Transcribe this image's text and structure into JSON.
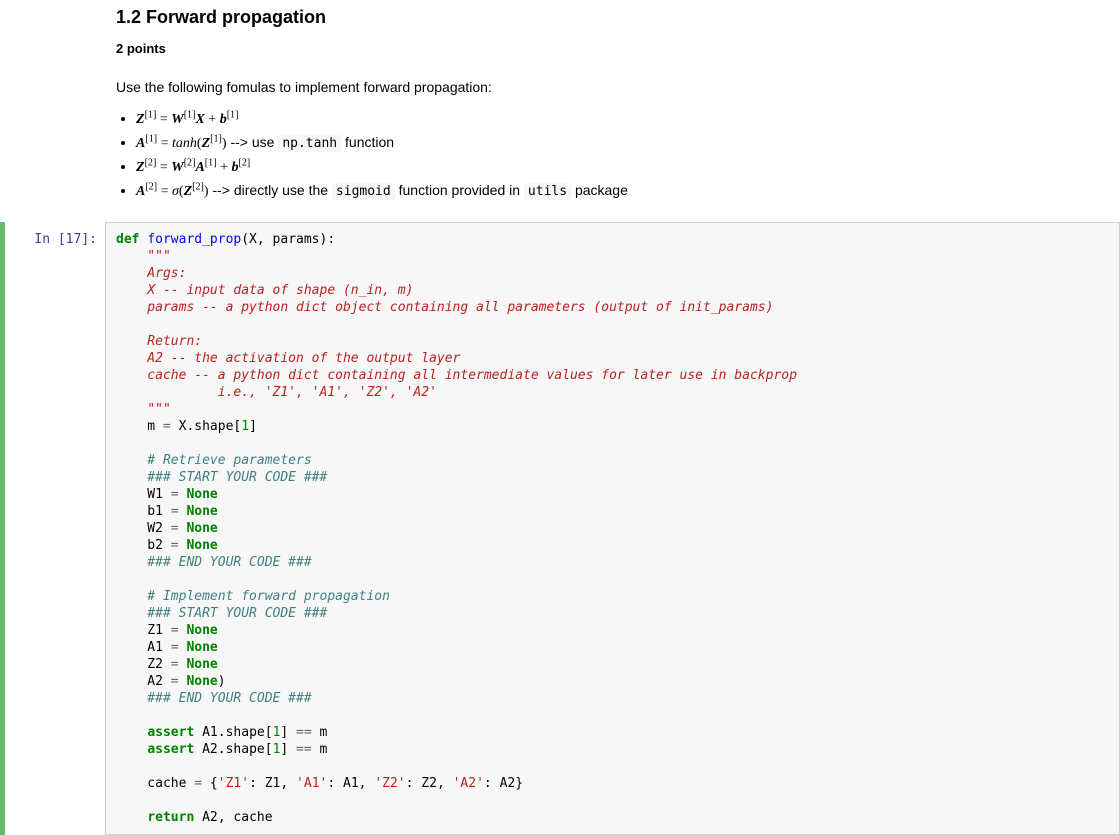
{
  "markdown": {
    "title": "1.2 Forward propagation",
    "points": "2 points",
    "intro": "Use the following fomulas to implement forward propagation:",
    "formula1_after": " --> use ",
    "formula1_code": "np.tanh",
    "formula1_tail": " function",
    "formula4_after": " --> directly use the ",
    "formula4_code1": "sigmoid",
    "formula4_mid": " function provided in ",
    "formula4_code2": "utils",
    "formula4_tail": " package"
  },
  "cell": {
    "prompt": "In [17]:",
    "line01_def": "def",
    "line01_fn": "forward_prop",
    "line01_rest": "(X, params):",
    "doc_open": "    \"\"\"",
    "doc_l1": "    Args:",
    "doc_l2": "    X -- input data of shape (n_in, m)",
    "doc_l3": "    params -- a python dict object containing all parameters (output of init_params)",
    "doc_blank": "    ",
    "doc_l4": "    Return:",
    "doc_l5": "    A2 -- the activation of the output layer",
    "doc_l6": "    cache -- a python dict containing all intermediate values for later use in backprop",
    "doc_l7": "             i.e., 'Z1', 'A1', 'Z2', 'A2'",
    "doc_close": "    \"\"\"",
    "m_line_a": "    m ",
    "eq": "=",
    "m_line_b": " X.shape[",
    "one": "1",
    "rb": "]",
    "cmt_retrieve": "    # Retrieve parameters",
    "cmt_start": "    ### START YOUR CODE ###",
    "w1": "    W1 ",
    "b1": "    b1 ",
    "w2": "    W2 ",
    "b2": "    b2 ",
    "none": "None",
    "cmt_end": "    ### END YOUR CODE ###",
    "cmt_impl": "    # Implement forward propagation",
    "z1": "    Z1 ",
    "a1": "    A1 ",
    "z2": "    Z2 ",
    "a2": "    A2 ",
    "a2_paren": ")",
    "assert_w": "assert",
    "assert1_a": " A1.shape[",
    "assert1_b": "] ",
    "eqeq": "==",
    "assert_tail": " m",
    "assert2_a": " A2.shape[",
    "cache_a": "    cache ",
    "cache_b": " {",
    "s_z1": "'Z1'",
    "s_a1": "'A1'",
    "s_z2": "'Z2'",
    "s_a2": "'A2'",
    "colon_z1": ": Z1, ",
    "colon_a1": ": A1, ",
    "colon_z2": ": Z2, ",
    "colon_a2": ": A2}",
    "return_w": "return",
    "return_tail": " A2, cache"
  }
}
